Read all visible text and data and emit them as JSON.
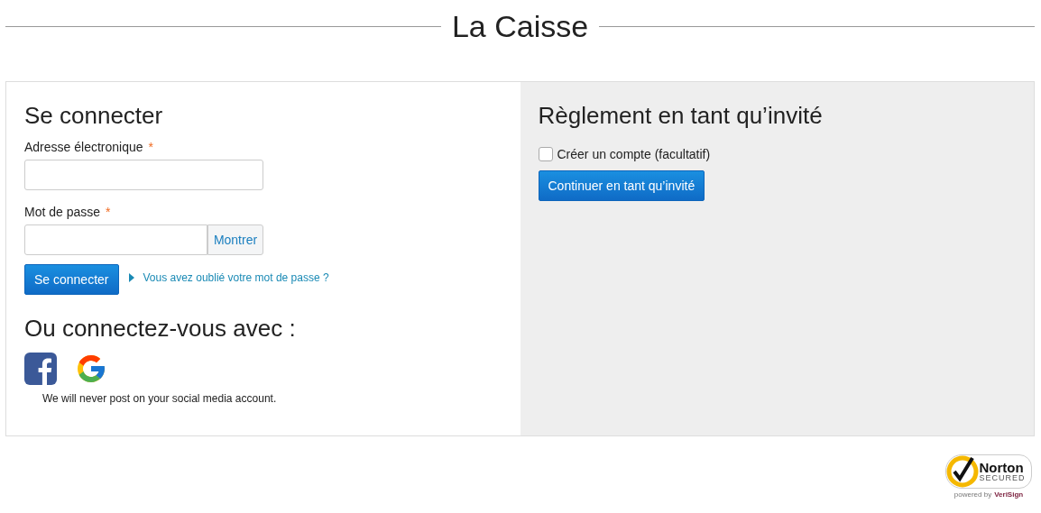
{
  "page_title": "La Caisse",
  "login": {
    "heading": "Se connecter",
    "fields": [
      {
        "label": "Adresse électronique",
        "required_mark": "*",
        "kind": "text"
      },
      {
        "label": "Mot de passe",
        "required_mark": "*",
        "kind": "password",
        "button": "Montrer"
      }
    ],
    "submit": "Se connecter",
    "forgot_link": "Vous avez oublié votre mot de passe ?",
    "social_heading": "Ou connectez-vous avec :",
    "social": [
      {
        "kind": "facebook"
      },
      {
        "kind": "google"
      }
    ],
    "note": "We will never post on your social media account."
  },
  "guest": {
    "heading": "Règlement en tant qu’invité",
    "checkbox": {
      "label": "Créer un compte (facultatif)",
      "checked": false
    },
    "button": "Continuer en tant qu’invité"
  },
  "badge": {
    "name": "Norton",
    "status": "SECURED",
    "powered_by": "powered by",
    "provider": "VeriSign"
  }
}
